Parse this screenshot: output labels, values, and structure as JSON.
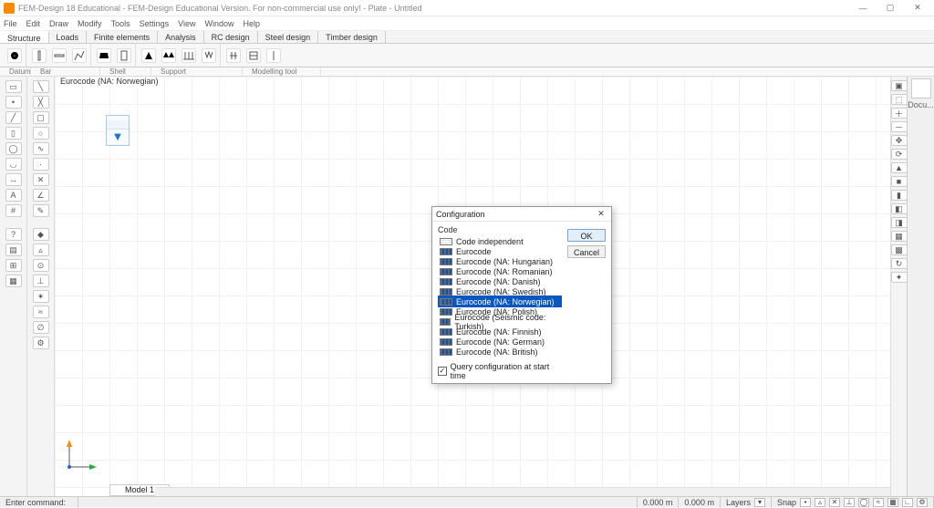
{
  "app_title": "FEM-Design 18 Educational - FEM-Design Educational Version.  For non-commercial use only! - Plate - Untitled",
  "menus": [
    "File",
    "Edit",
    "Draw",
    "Modify",
    "Tools",
    "Settings",
    "View",
    "Window",
    "Help"
  ],
  "tabs": [
    "Structure",
    "Loads",
    "Finite elements",
    "Analysis",
    "RC design",
    "Steel design",
    "Timber design"
  ],
  "active_tab_index": 0,
  "ribbon_groups": [
    "Datum",
    "Bar",
    "Shell",
    "Support",
    "Modelling tool"
  ],
  "doc_panel_label": "Docu...",
  "selection_info": "Eurocode (NA: Norwegian)",
  "model_tab_label": "Model 1",
  "dialog": {
    "title": "Configuration",
    "section": "Code",
    "ok": "OK",
    "cancel": "Cancel",
    "query_label": "Query configuration at start time",
    "query_checked": true,
    "selected_index": 5,
    "codes": [
      "Code independent",
      "Eurocode",
      "Eurocode (NA: Hungarian)",
      "Eurocode (NA: Romanian)",
      "Eurocode (NA: Danish)",
      "Eurocode (NA: Swedish)",
      "Eurocode (NA: Norwegian)",
      "Eurocode (NA: Polish)",
      "Eurocode (Seismic code: Turkish)",
      "Eurocode (NA: Finnish)",
      "Eurocode (NA: German)",
      "Eurocode (NA: British)"
    ]
  },
  "status": {
    "enter_command_label": "Enter command:",
    "coord_x": "0.000 m",
    "coord_y": "0.000 m",
    "layers_label": "Layers",
    "snap_label": "Snap"
  }
}
